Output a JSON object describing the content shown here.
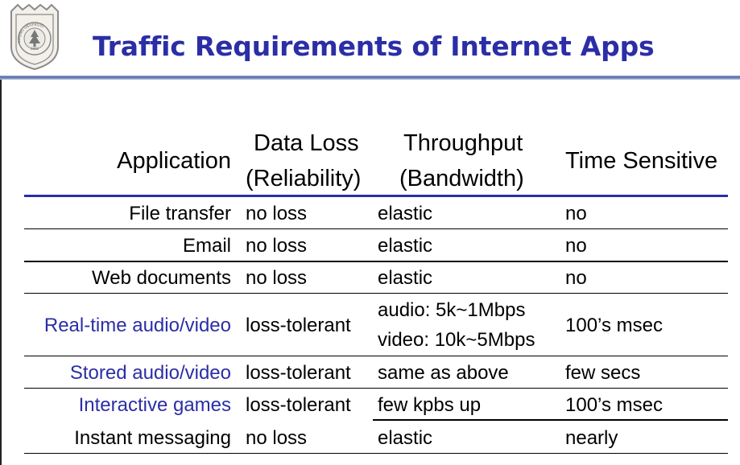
{
  "slide": {
    "title": "Traffic Requirements of Internet Apps",
    "logo_text": "NANJING UNIVERSITY",
    "logo_year": "1902"
  },
  "table": {
    "headers": {
      "application": "Application",
      "data_loss_1": "Data Loss",
      "data_loss_2": "(Reliability)",
      "throughput_1": "Throughput",
      "throughput_2": "(Bandwidth)",
      "time_sensitive": "Time Sensitive"
    },
    "rows": [
      {
        "app": "File transfer",
        "loss": "no loss",
        "throughput": "elastic",
        "time": "no"
      },
      {
        "app": "Email",
        "loss": "no loss",
        "throughput": "elastic",
        "time": "no"
      },
      {
        "app": "Web documents",
        "loss": "no loss",
        "throughput": "elastic",
        "time": "no"
      },
      {
        "app": "Real-time audio/video",
        "loss": "loss-tolerant",
        "throughput_1": "audio: 5k~1Mbps",
        "throughput_2": "video: 10k~5Mbps",
        "time": "100’s msec"
      },
      {
        "app": "Stored audio/video",
        "loss": "loss-tolerant",
        "throughput": "same as above",
        "time": "few secs"
      },
      {
        "app": "Interactive games",
        "loss": "loss-tolerant",
        "throughput": "few kpbs up",
        "time": "100’s msec"
      },
      {
        "app": "Instant messaging",
        "loss": "no loss",
        "throughput": "elastic",
        "time": "nearly"
      }
    ]
  },
  "colors": {
    "title": "#2b2ea6",
    "highlight_app": "#2b2ea6"
  }
}
